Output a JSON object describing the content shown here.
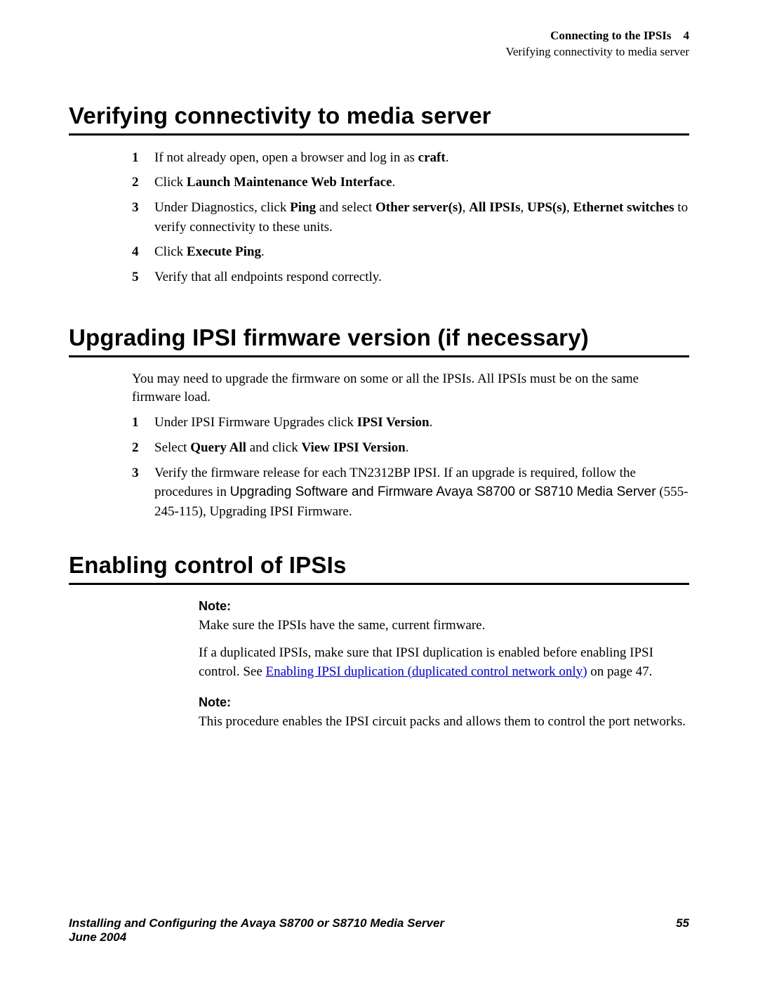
{
  "header": {
    "chapter": "Connecting to the IPSIs",
    "chapnum": "4",
    "subtitle": "Verifying connectivity to media server"
  },
  "s1": {
    "title": "Verifying connectivity to media server",
    "steps": {
      "n1": "1",
      "t1a": "If not already open, open a browser and log in as ",
      "t1b": "craft",
      "t1c": ".",
      "n2": "2",
      "t2a": "Click ",
      "t2b": "Launch Maintenance Web Interface",
      "t2c": ".",
      "n3": "3",
      "t3a": "Under Diagnostics, click ",
      "t3b": "Ping",
      "t3c": " and select ",
      "t3d": "Other server(s)",
      "t3e": ", ",
      "t3f": "All IPSIs",
      "t3g": ", ",
      "t3h": "UPS(s)",
      "t3i": ", ",
      "t3j": "Ethernet switches",
      "t3k": " to verify connectivity to these units.",
      "n4": "4",
      "t4a": "Click ",
      "t4b": "Execute Ping",
      "t4c": ".",
      "n5": "5",
      "t5": "Verify that all endpoints respond correctly."
    }
  },
  "s2": {
    "title": "Upgrading IPSI firmware version (if necessary)",
    "intro": "You may need to upgrade the firmware on some or all the IPSIs. All IPSIs must be on the same firmware load.",
    "steps": {
      "n1": "1",
      "t1a": "Under IPSI Firmware Upgrades click ",
      "t1b": "IPSI Version",
      "t1c": ".",
      "n2": "2",
      "t2a": "Select ",
      "t2b": "Query All",
      "t2c": " and click ",
      "t2d": "View IPSI Version",
      "t2e": ".",
      "n3": "3",
      "t3a": "Verify the firmware release for each TN2312BP IPSI. If an upgrade is required, follow the procedures in ",
      "t3b": "Upgrading Software and Firmware Avaya S8700 or S8710 Media Server",
      "t3c": " (555-245-115), Upgrading IPSI Firmware."
    }
  },
  "s3": {
    "title": "Enabling control of IPSIs",
    "note1_label": "Note:",
    "note1_body1": "Make sure the IPSIs have the same, current firmware.",
    "note1_body2a": "If a duplicated IPSIs, make sure that IPSI duplication is enabled before enabling IPSI control. See ",
    "note1_link": "Enabling IPSI duplication (duplicated control network only)",
    "note1_body2b": " on page 47.",
    "note2_label": "Note:",
    "note2_body": "This procedure enables the IPSI circuit packs and allows them to control the port networks."
  },
  "footer": {
    "title": "Installing and Configuring the Avaya S8700 or S8710 Media Server",
    "date": "June 2004",
    "page": "55"
  }
}
